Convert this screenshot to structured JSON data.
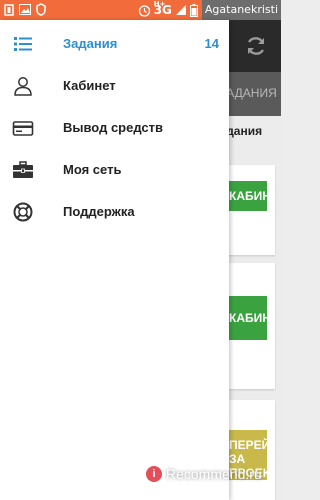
{
  "status_bar": {
    "network": "3G",
    "network_super": "H+",
    "watermark_text": "Agatanekristi"
  },
  "drawer": {
    "items": [
      {
        "label": "Задания",
        "count": "14",
        "icon": "list-icon",
        "active": true
      },
      {
        "label": "Кабинет",
        "icon": "user-icon"
      },
      {
        "label": "Вывод средств",
        "icon": "credit-card-icon"
      },
      {
        "label": "Моя сеть",
        "icon": "briefcase-icon"
      },
      {
        "label": "Поддержка",
        "icon": "lifebuoy-icon"
      }
    ]
  },
  "background": {
    "tab_label": "ЗАДАНИЯ",
    "heading": "Задания",
    "card_buttons": [
      "КАБИНЕТ",
      "КАБИНЕТ",
      "ПЕРЕЙТИ ЗА ПРОЕКТ"
    ]
  },
  "watermark": {
    "logo": "i",
    "text": "Recommend.ru"
  },
  "colors": {
    "status_bar": "#f26b3a",
    "accent": "#2e8fd0",
    "toolbar": "#2a2a2a",
    "button_green": "#3aa33f"
  }
}
